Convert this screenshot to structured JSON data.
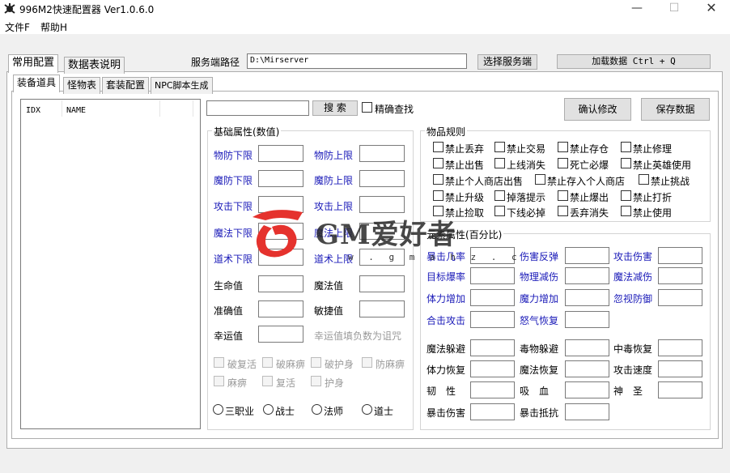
{
  "window": {
    "title": "996M2快速配置器 Ver1.0.6.0",
    "icon": "gear-app-icon",
    "min": "—",
    "max": "☐",
    "close": "✕"
  },
  "menu": {
    "file": "文件F",
    "help": "帮助H"
  },
  "top_tabs": [
    "常用配置",
    "数据表说明"
  ],
  "server": {
    "label": "服务端路径",
    "path": "D:\\Mirserver",
    "choose_btn": "选择服务端",
    "load_btn": "加载数据 Ctrl + Q"
  },
  "sub_tabs": [
    "装备道具",
    "怪物表",
    "套装配置",
    "NPC脚本生成"
  ],
  "list": {
    "col_idx": "IDX",
    "col_name": "NAME"
  },
  "search": {
    "value": "",
    "button": "搜 索",
    "exact": "精确查找"
  },
  "actions": {
    "confirm": "确认修改",
    "save": "保存数据"
  },
  "base_attrs": {
    "title": "基础属性(数值)",
    "rows": [
      [
        "物防下限",
        "物防上限"
      ],
      [
        "魔防下限",
        "魔防上限"
      ],
      [
        "攻击下限",
        "攻击上限"
      ],
      [
        "魔法下限",
        "魔法上限"
      ],
      [
        "道术下限",
        "道术上限"
      ],
      [
        "生命值",
        "魔法值"
      ],
      [
        "准确值",
        "敏捷值"
      ]
    ],
    "luck": "幸运值",
    "luck_hint": "幸运值填负数为诅咒",
    "flags": [
      [
        "破复活",
        "破麻痹",
        "破护身",
        "防麻痹"
      ],
      [
        "麻痹",
        "复活",
        "护身"
      ]
    ],
    "jobs": [
      "三职业",
      "战士",
      "法师",
      "道士"
    ]
  },
  "item_rules": {
    "title": "物品规则",
    "rows": [
      [
        "禁止丢弃",
        "禁止交易",
        "禁止存仓",
        "禁止修理"
      ],
      [
        "禁止出售",
        "上线消失",
        "死亡必爆",
        "禁止英雄使用"
      ],
      [
        "禁止个人商店出售",
        "禁止存入个人商店",
        "禁止挑战"
      ],
      [
        "禁止升级",
        "掉落提示",
        "禁止爆出",
        "禁止打折"
      ],
      [
        "禁止捡取",
        "下线必掉",
        "丢弃消失",
        "禁止使用"
      ]
    ]
  },
  "elem_attrs": {
    "title": "元素属性(百分比)",
    "blue_rows": [
      [
        "暴击几率",
        "伤害反弹",
        "攻击伤害"
      ],
      [
        "目标爆率",
        "物理减伤",
        "魔法减伤"
      ],
      [
        "体力增加",
        "魔力增加",
        "忽视防御"
      ],
      [
        "合击攻击",
        "怒气恢复"
      ]
    ],
    "black_rows": [
      [
        "魔法躲避",
        "毒物躲避",
        "中毒恢复"
      ],
      [
        "体力恢复",
        "魔法恢复",
        "攻击速度"
      ],
      [
        "韧　性",
        "吸　血",
        "神　圣"
      ],
      [
        "暴击伤害",
        "暴击抵抗"
      ]
    ]
  },
  "watermark": {
    "text": "GM爱好者",
    "url": "w . g m a h z . c"
  },
  "colors": {
    "blue_label": "#1a1ab8",
    "logo_red": "#e5322d"
  }
}
